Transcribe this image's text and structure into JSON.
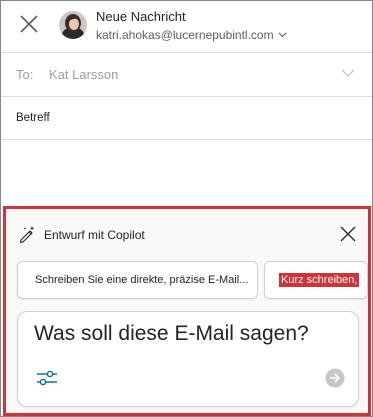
{
  "header": {
    "title": "Neue Nachricht",
    "from_address": "katri.ahokas@lucernepubintl.com"
  },
  "to": {
    "label": "To:",
    "value": "Kat Larsson"
  },
  "subject": {
    "label": "Betreff",
    "value": ""
  },
  "copilot": {
    "title": "Entwurf mit Copilot",
    "suggestions": [
      {
        "label": "Schreiben Sie eine direkte, präzise E-Mail..."
      },
      {
        "label": "Kurz schreiben,"
      }
    ],
    "prompt_placeholder": "Was soll diese E-Mail sagen?",
    "highlight_color": "#d13438"
  },
  "icons": {
    "close": "close-icon",
    "chevron": "chevron-down-icon",
    "copilot": "copilot-pen-icon",
    "settings": "sliders-icon",
    "send": "send-arrow-icon"
  }
}
